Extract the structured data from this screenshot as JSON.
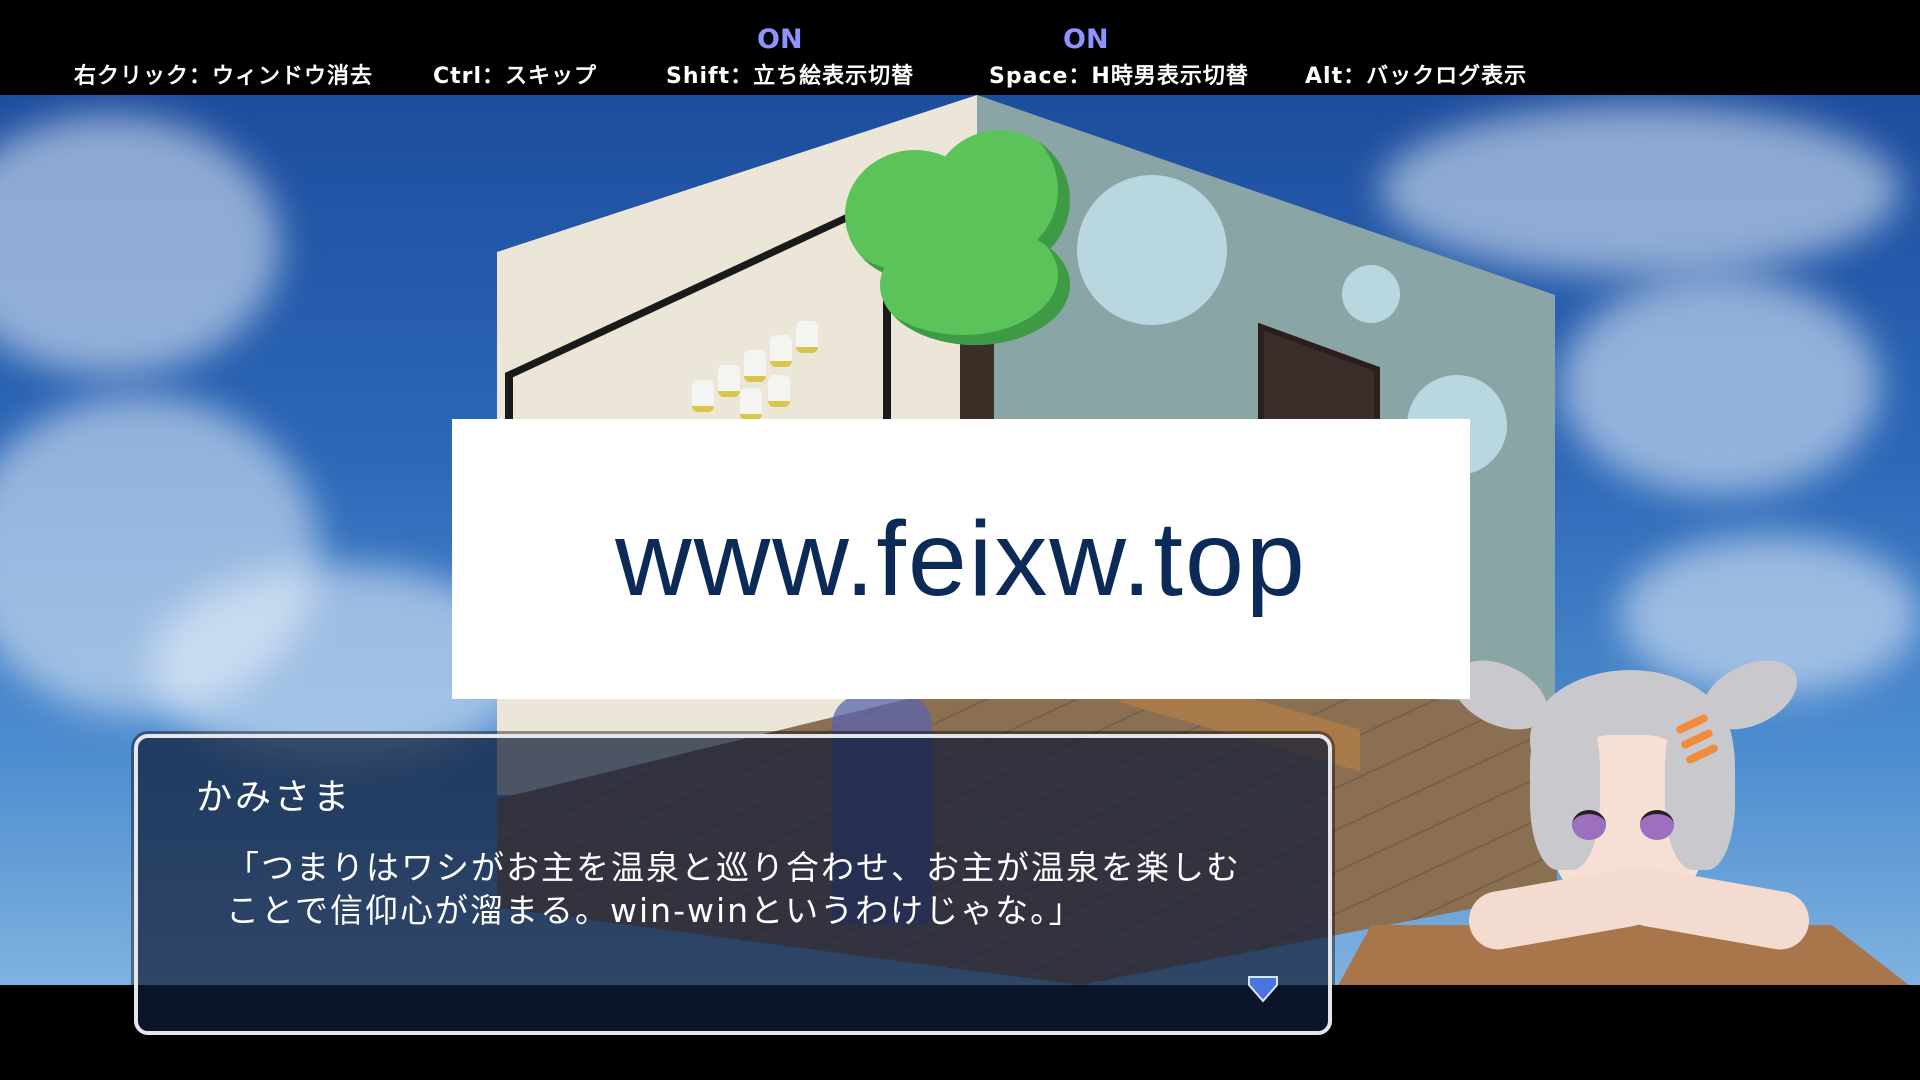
{
  "hints": {
    "right_click": "右クリック：ウィンドウ消去",
    "ctrl": "Ctrl：スキップ",
    "shift": "Shift：立ち絵表示切替",
    "space": "Space：H時男表示切替",
    "alt": "Alt：バックログ表示",
    "shift_state": "ON",
    "space_state": "ON"
  },
  "watermark": "www.feixw.top",
  "message": {
    "speaker": "かみさま",
    "text": "「つまりはワシがお主を温泉と巡り合わせ、お主が温泉を楽しむことで信仰心が溜まる。win-winというわけじゃな。」"
  },
  "colors": {
    "on_indicator": "#8f93ff",
    "message_bg": "#0f1c37",
    "advance_icon": "#4a74e0"
  },
  "icons": {
    "advance": "heart-advance-icon"
  }
}
